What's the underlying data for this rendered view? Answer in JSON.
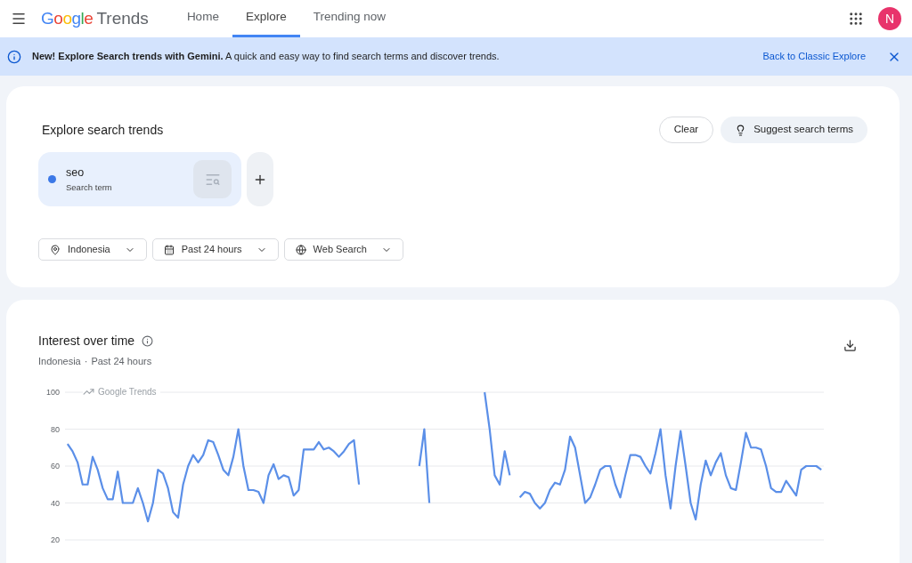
{
  "header": {
    "logo": {
      "brand": "Google",
      "product": "Trends"
    },
    "tabs": [
      {
        "label": "Home",
        "selected": false
      },
      {
        "label": "Explore",
        "selected": true
      },
      {
        "label": "Trending now",
        "selected": false
      }
    ],
    "avatar": "N"
  },
  "banner": {
    "message": "**New! Explore Search trends with Gemini.** A quick and easy way to find search terms and discover trends.",
    "link": "Back to Classic Explore"
  },
  "explore": {
    "title": "Explore search trends",
    "buttons": [
      {
        "label": "Clear",
        "kind": "outline"
      },
      {
        "label": "Suggest search terms",
        "kind": "tonal"
      }
    ],
    "terms": [
      {
        "name": "seo",
        "type": "Search term",
        "color": "#3b78e7"
      }
    ],
    "filters": [
      {
        "label": "Indonesia",
        "kind": "location"
      },
      {
        "label": "Past 24 hours",
        "kind": "time"
      },
      {
        "label": "Web Search",
        "kind": "property"
      }
    ]
  },
  "interest": {
    "title": "Interest over time",
    "subtitle": [
      "Indonesia",
      "·",
      "Past 24 hours"
    ],
    "chart_brand": "Google Trends",
    "chart_data": {
      "type": "line",
      "grid": true,
      "ylim": [
        20,
        100
      ],
      "yticks": [
        20,
        40,
        60,
        80,
        100
      ],
      "series": [
        {
          "color": "#5b8fe8",
          "values": [
            72,
            68,
            62,
            50,
            50,
            65,
            58,
            48,
            42,
            42,
            57,
            40,
            40,
            40,
            48,
            40,
            30,
            40,
            58,
            56,
            48,
            35,
            32,
            50,
            60,
            66,
            62,
            66,
            74,
            73,
            66,
            58,
            55,
            65,
            80,
            60,
            47,
            47,
            46,
            40,
            55,
            61,
            53,
            55,
            54,
            44,
            47,
            69,
            69,
            69,
            73,
            69,
            70,
            68,
            65,
            68,
            72,
            74,
            50,
            null,
            null,
            null,
            null,
            null,
            null,
            null,
            null,
            null,
            null,
            null,
            60,
            80,
            40,
            null,
            null,
            null,
            null,
            null,
            null,
            null,
            null,
            null,
            null,
            100,
            80,
            55,
            50,
            68,
            55,
            null,
            43,
            46,
            45,
            40,
            37,
            40,
            47,
            51,
            50,
            58,
            76,
            70,
            55,
            40,
            43,
            50,
            58,
            60,
            60,
            50,
            43,
            55,
            66,
            66,
            65,
            60,
            56,
            67,
            80,
            55,
            37,
            60,
            79,
            60,
            40,
            31,
            50,
            63,
            55,
            62,
            67,
            55,
            48,
            47,
            62,
            78,
            70,
            70,
            69,
            60,
            48,
            46,
            46,
            52,
            48,
            44,
            58,
            60,
            60,
            60,
            58
          ]
        }
      ]
    }
  }
}
